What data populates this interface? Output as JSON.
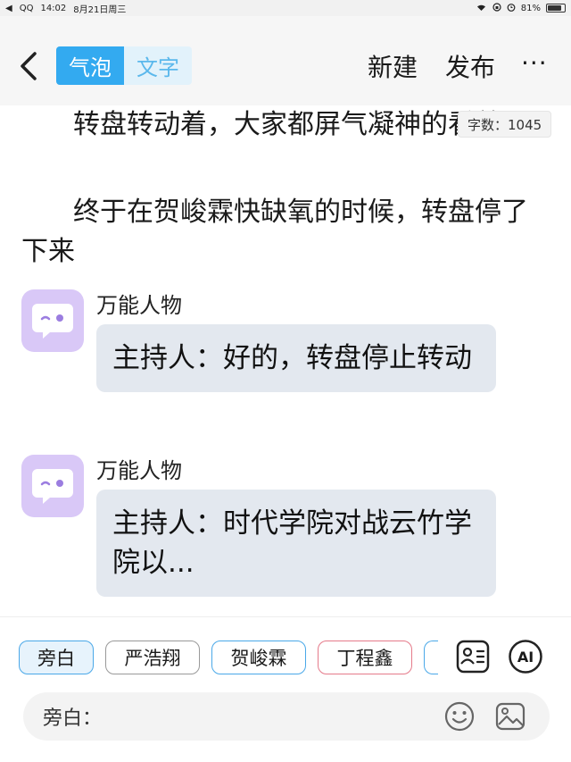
{
  "status_bar": {
    "app": "QQ",
    "time": "14:02",
    "date": "8月21日周三",
    "battery": "81%",
    "battery_level": 0.81
  },
  "nav": {
    "tabs": [
      {
        "label": "气泡",
        "active": true
      },
      {
        "label": "文字",
        "active": false
      }
    ],
    "new_label": "新建",
    "publish_label": "发布",
    "more_label": "···"
  },
  "content": {
    "word_count": "字数：1045",
    "paragraphs": [
      "转盘转动着，大家都屏气凝神的看着",
      "终于在贺峻霖快缺氧的时候，转盘停了下来"
    ],
    "messages": [
      {
        "name": "万能人物",
        "text": "主持人：好的，转盘停止转动"
      },
      {
        "name": "万能人物",
        "text": "主持人：时代学院对战云竹学院以..."
      }
    ]
  },
  "bottom": {
    "characters": [
      {
        "label": "旁白",
        "color": "#4aa8e8",
        "selected": true
      },
      {
        "label": "严浩翔",
        "color": "#999999",
        "selected": false
      },
      {
        "label": "贺峻霖",
        "color": "#4aa8e8",
        "selected": false
      },
      {
        "label": "丁程鑫",
        "color": "#e57a8a",
        "selected": false
      }
    ],
    "ai_label": "AI",
    "input_label": "旁白：",
    "input_value": "",
    "icons": [
      "contacts-icon",
      "ai-icon",
      "emoji-icon",
      "image-icon"
    ]
  },
  "colors": {
    "accent": "#33aaf0",
    "accent_light": "#e2f2fb",
    "bubble": "#e3e8ef",
    "avatar": "#d9c8f7"
  }
}
